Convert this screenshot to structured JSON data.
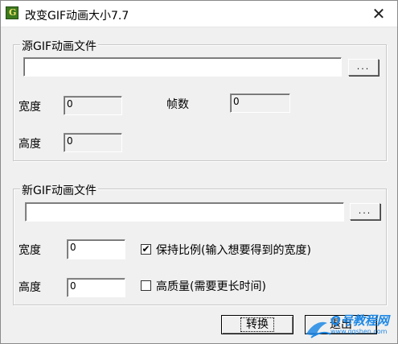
{
  "window": {
    "title": "改变GIF动画大小7.7",
    "close_glyph": "✕"
  },
  "source": {
    "group_label": "源GIF动画文件",
    "file_path": "",
    "browse_label": "...",
    "width_label": "宽度",
    "width_value": "0",
    "frames_label": "帧数",
    "frames_value": "0",
    "height_label": "高度",
    "height_value": "0"
  },
  "target": {
    "group_label": "新GIF动画文件",
    "file_path": "",
    "browse_label": "...",
    "width_label": "宽度",
    "width_value": "0",
    "height_label": "高度",
    "height_value": "0",
    "keep_ratio_label": "保持比例(输入想要得到的宽度)",
    "keep_ratio_checked": true,
    "high_quality_label": "高质量(需要更长时间)",
    "high_quality_checked": false
  },
  "buttons": {
    "convert_label": "转换",
    "exit_label": "退出"
  },
  "watermark": {
    "text": "Q号教程网",
    "url": "www.qqshen.com"
  },
  "colors": {
    "accent": "#1e88e5",
    "icon_bg": "#3c7a1e"
  }
}
